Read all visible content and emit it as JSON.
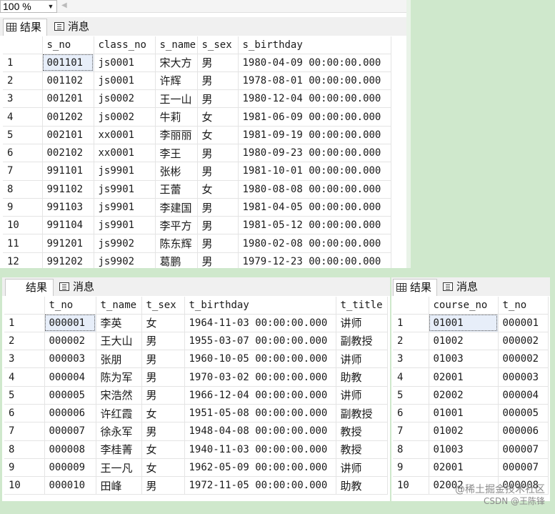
{
  "zoom": {
    "value": "100 %"
  },
  "tabs": {
    "results": "结果",
    "messages": "消息"
  },
  "students": {
    "columns": [
      "s_no",
      "class_no",
      "s_name",
      "s_sex",
      "s_birthday"
    ],
    "rows": [
      [
        "1",
        "001101",
        "js0001",
        "宋大方",
        "男",
        "1980-04-09 00:00:00.000"
      ],
      [
        "2",
        "001102",
        "js0001",
        "许辉",
        "男",
        "1978-08-01 00:00:00.000"
      ],
      [
        "3",
        "001201",
        "js0002",
        "王一山",
        "男",
        "1980-12-04 00:00:00.000"
      ],
      [
        "4",
        "001202",
        "js0002",
        "牛莉",
        "女",
        "1981-06-09 00:00:00.000"
      ],
      [
        "5",
        "002101",
        "xx0001",
        "李丽丽",
        "女",
        "1981-09-19 00:00:00.000"
      ],
      [
        "6",
        "002102",
        "xx0001",
        "李王",
        "男",
        "1980-09-23 00:00:00.000"
      ],
      [
        "7",
        "991101",
        "js9901",
        "张彬",
        "男",
        "1981-10-01 00:00:00.000"
      ],
      [
        "8",
        "991102",
        "js9901",
        "王蕾",
        "女",
        "1980-08-08 00:00:00.000"
      ],
      [
        "9",
        "991103",
        "js9901",
        "李建国",
        "男",
        "1981-04-05 00:00:00.000"
      ],
      [
        "10",
        "991104",
        "js9901",
        "李平方",
        "男",
        "1981-05-12 00:00:00.000"
      ],
      [
        "11",
        "991201",
        "js9902",
        "陈东辉",
        "男",
        "1980-02-08 00:00:00.000"
      ],
      [
        "12",
        "991202",
        "js9902",
        "葛鹏",
        "男",
        "1979-12-23 00:00:00.000"
      ]
    ]
  },
  "teachers": {
    "columns": [
      "t_no",
      "t_name",
      "t_sex",
      "t_birthday",
      "t_title"
    ],
    "rows": [
      [
        "1",
        "000001",
        "李英",
        "女",
        "1964-11-03 00:00:00.000",
        "讲师"
      ],
      [
        "2",
        "000002",
        "王大山",
        "男",
        "1955-03-07 00:00:00.000",
        "副教授"
      ],
      [
        "3",
        "000003",
        "张朋",
        "男",
        "1960-10-05 00:00:00.000",
        "讲师"
      ],
      [
        "4",
        "000004",
        "陈为军",
        "男",
        "1970-03-02 00:00:00.000",
        "助教"
      ],
      [
        "5",
        "000005",
        "宋浩然",
        "男",
        "1966-12-04 00:00:00.000",
        "讲师"
      ],
      [
        "6",
        "000006",
        "许红霞",
        "女",
        "1951-05-08 00:00:00.000",
        "副教授"
      ],
      [
        "7",
        "000007",
        "徐永军",
        "男",
        "1948-04-08 00:00:00.000",
        "教授"
      ],
      [
        "8",
        "000008",
        "李桂菁",
        "女",
        "1940-11-03 00:00:00.000",
        "教授"
      ],
      [
        "9",
        "000009",
        "王一凡",
        "女",
        "1962-05-09 00:00:00.000",
        "讲师"
      ],
      [
        "10",
        "000010",
        "田峰",
        "男",
        "1972-11-05 00:00:00.000",
        "助教"
      ]
    ]
  },
  "course_teacher": {
    "columns": [
      "course_no",
      "t_no"
    ],
    "rows": [
      [
        "1",
        "01001",
        "000001"
      ],
      [
        "2",
        "01002",
        "000002"
      ],
      [
        "3",
        "01003",
        "000002"
      ],
      [
        "4",
        "02001",
        "000003"
      ],
      [
        "5",
        "02002",
        "000004"
      ],
      [
        "6",
        "01001",
        "000005"
      ],
      [
        "7",
        "01002",
        "000006"
      ],
      [
        "8",
        "01003",
        "000007"
      ],
      [
        "9",
        "02001",
        "000007"
      ],
      [
        "10",
        "02002",
        "000008"
      ]
    ]
  },
  "watermark": {
    "line1": "@稀土掘金技术社区",
    "line2": "CSDN @王陈锋"
  }
}
